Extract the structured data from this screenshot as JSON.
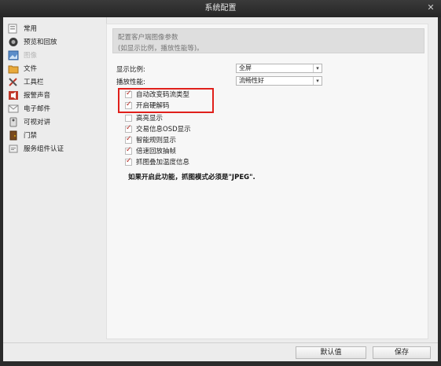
{
  "window": {
    "title": "系统配置"
  },
  "sidebar": {
    "items": [
      {
        "label": "常用",
        "icon": "common-icon",
        "disabled": false
      },
      {
        "label": "预览和回放",
        "icon": "preview-playback-icon",
        "disabled": false
      },
      {
        "label": "图像",
        "icon": "image-icon",
        "disabled": true
      },
      {
        "label": "文件",
        "icon": "file-icon",
        "disabled": false
      },
      {
        "label": "工具栏",
        "icon": "toolbar-icon",
        "disabled": false
      },
      {
        "label": "报警声音",
        "icon": "alarm-sound-icon",
        "disabled": false
      },
      {
        "label": "电子邮件",
        "icon": "email-icon",
        "disabled": false
      },
      {
        "label": "可视对讲",
        "icon": "video-intercom-icon",
        "disabled": false
      },
      {
        "label": "门禁",
        "icon": "access-control-icon",
        "disabled": false
      },
      {
        "label": "服务组件认证",
        "icon": "service-auth-icon",
        "disabled": false
      }
    ]
  },
  "header": {
    "line1": "配置客户端图像参数",
    "line2": "(如显示比例，播放性能等)。"
  },
  "settings": {
    "display_ratio": {
      "label": "显示比例:",
      "value": "全屏"
    },
    "playback_perf": {
      "label": "播放性能:",
      "value": "流畅性好"
    }
  },
  "checkboxes": [
    {
      "label": "自动改变码流类型",
      "checked": true
    },
    {
      "label": "开启硬解码",
      "checked": true
    },
    {
      "label": "高亮显示",
      "checked": false
    },
    {
      "label": "交易信息OSD显示",
      "checked": true
    },
    {
      "label": "智能规则显示",
      "checked": true
    },
    {
      "label": "倍速回放抽帧",
      "checked": true
    },
    {
      "label": "抓图叠加温度信息",
      "checked": true
    }
  ],
  "note": "如果开启此功能，抓图模式必须是\"JPEG\".",
  "buttons": {
    "default": "默认值",
    "save": "保存"
  },
  "colors": {
    "highlight_border": "#e0201b",
    "check_mark": "#b3261e"
  }
}
